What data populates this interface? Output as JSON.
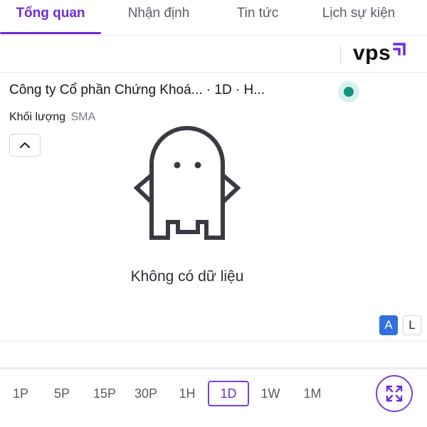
{
  "tabs": [
    {
      "label": "Tổng quan",
      "active": true
    },
    {
      "label": "Nhận định",
      "active": false
    },
    {
      "label": "Tin tức",
      "active": false
    },
    {
      "label": "Lịch sự kiện",
      "active": false
    }
  ],
  "brand": {
    "text": "vps",
    "icon": "vps-logo-icon"
  },
  "chart": {
    "title": "Công ty Cổ phần Chứng Khoá...   · 1D · H...",
    "status_color": "#12937c",
    "indicator": {
      "name": "Khối lượng",
      "sub": "SMA"
    },
    "empty_message": "Không có dữ liệu",
    "empty_icon": "ghost-icon"
  },
  "scale": {
    "options": [
      {
        "label": "A",
        "active": true
      },
      {
        "label": "L",
        "active": false
      }
    ]
  },
  "intervals": [
    {
      "label": "1P",
      "active": false
    },
    {
      "label": "5P",
      "active": false
    },
    {
      "label": "15P",
      "active": false
    },
    {
      "label": "30P",
      "active": false
    },
    {
      "label": "1H",
      "active": false
    },
    {
      "label": "1D",
      "active": true
    },
    {
      "label": "1W",
      "active": false
    },
    {
      "label": "1M",
      "active": false
    }
  ],
  "colors": {
    "accent": "#6f2bd9",
    "scale_active": "#2f6fde",
    "status": "#12937c"
  }
}
